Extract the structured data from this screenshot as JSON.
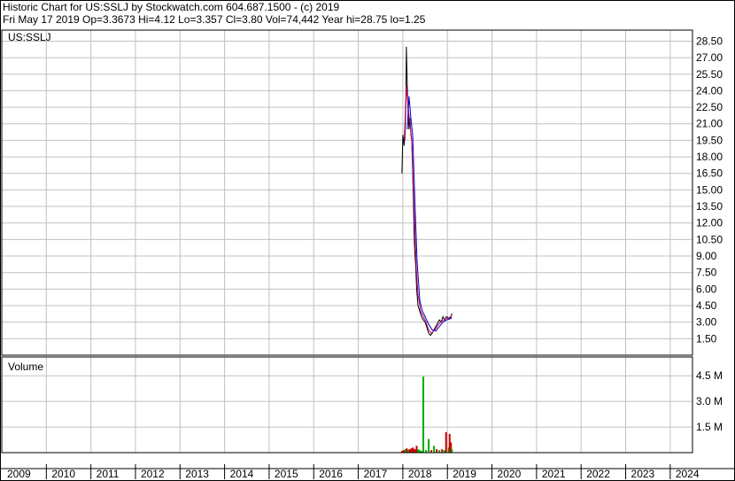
{
  "header": {
    "line1": "Historic Chart for US:SSLJ by Stockwatch.com 604.687.1500 - (c) 2019",
    "line2": "Fri May 17 2019  Op=3.3673  Hi=4.12  Lo=3.357  Cl=3.80  Vol=74,442  Year hi=28.75  lo=1.25"
  },
  "chart_data": [
    {
      "type": "line",
      "panel": "price",
      "label": "US:SSLJ",
      "x_ticks": [
        "2009",
        "2010",
        "2011",
        "2012",
        "2013",
        "2014",
        "2015",
        "2016",
        "2017",
        "2018",
        "2019",
        "2020",
        "2021",
        "2022",
        "2023",
        "2024"
      ],
      "xlim": [
        2009.0,
        2024.5
      ],
      "y_ticks": [
        "28.50",
        "27.00",
        "25.50",
        "24.00",
        "22.50",
        "21.00",
        "19.50",
        "18.00",
        "16.50",
        "15.00",
        "13.50",
        "12.00",
        "10.50",
        "9.00",
        "7.50",
        "6.00",
        "4.50",
        "3.00",
        "1.50"
      ],
      "ylim": [
        0.0,
        29.5
      ],
      "grid": true,
      "series": [
        {
          "role": "price",
          "color": "#000000",
          "points": [
            [
              2017.98,
              16.5
            ],
            [
              2018.0,
              20.0
            ],
            [
              2018.03,
              19.0
            ],
            [
              2018.05,
              21.0
            ],
            [
              2018.07,
              23.5
            ],
            [
              2018.08,
              28.0
            ],
            [
              2018.1,
              24.5
            ],
            [
              2018.12,
              22.0
            ],
            [
              2018.14,
              20.5
            ],
            [
              2018.16,
              21.5
            ],
            [
              2018.18,
              20.0
            ],
            [
              2018.2,
              19.5
            ],
            [
              2018.23,
              15.0
            ],
            [
              2018.26,
              10.0
            ],
            [
              2018.29,
              8.0
            ],
            [
              2018.31,
              6.0
            ],
            [
              2018.34,
              4.5
            ],
            [
              2018.38,
              4.0
            ],
            [
              2018.42,
              3.5
            ],
            [
              2018.46,
              3.2
            ],
            [
              2018.5,
              3.0
            ],
            [
              2018.54,
              2.5
            ],
            [
              2018.58,
              2.0
            ],
            [
              2018.62,
              1.8
            ],
            [
              2018.66,
              2.0
            ],
            [
              2018.7,
              2.3
            ],
            [
              2018.74,
              2.6
            ],
            [
              2018.78,
              2.9
            ],
            [
              2018.82,
              3.2
            ],
            [
              2018.86,
              3.0
            ],
            [
              2018.9,
              3.5
            ],
            [
              2018.94,
              3.2
            ],
            [
              2018.98,
              3.5
            ],
            [
              2019.02,
              3.4
            ],
            [
              2019.05,
              3.3
            ],
            [
              2019.08,
              3.5
            ],
            [
              2019.1,
              3.8
            ]
          ]
        },
        {
          "role": "moving-average-short",
          "color": "#cc0066",
          "points": [
            [
              2018.05,
              19.5
            ],
            [
              2018.08,
              24.5
            ],
            [
              2018.12,
              22.5
            ],
            [
              2018.16,
              21.0
            ],
            [
              2018.2,
              19.5
            ],
            [
              2018.25,
              13.5
            ],
            [
              2018.3,
              8.0
            ],
            [
              2018.34,
              5.5
            ],
            [
              2018.4,
              4.0
            ],
            [
              2018.46,
              3.5
            ],
            [
              2018.52,
              3.0
            ],
            [
              2018.58,
              2.3
            ],
            [
              2018.64,
              2.0
            ],
            [
              2018.72,
              2.3
            ],
            [
              2018.8,
              2.8
            ],
            [
              2018.88,
              3.1
            ],
            [
              2018.96,
              3.3
            ],
            [
              2019.04,
              3.4
            ],
            [
              2019.1,
              3.6
            ]
          ]
        },
        {
          "role": "moving-average-long",
          "color": "#0000cc",
          "points": [
            [
              2018.1,
              20.5
            ],
            [
              2018.14,
              23.5
            ],
            [
              2018.18,
              21.5
            ],
            [
              2018.22,
              20.0
            ],
            [
              2018.27,
              14.0
            ],
            [
              2018.32,
              8.5
            ],
            [
              2018.38,
              5.0
            ],
            [
              2018.44,
              4.0
            ],
            [
              2018.5,
              3.5
            ],
            [
              2018.58,
              2.8
            ],
            [
              2018.66,
              2.3
            ],
            [
              2018.74,
              2.2
            ],
            [
              2018.82,
              2.6
            ],
            [
              2018.9,
              3.0
            ],
            [
              2018.98,
              3.2
            ],
            [
              2019.06,
              3.3
            ],
            [
              2019.1,
              3.4
            ]
          ]
        }
      ]
    },
    {
      "type": "bar",
      "panel": "volume",
      "title": "Volume",
      "y_ticks": [
        "4.5 M",
        "3.0 M",
        "1.5 M"
      ],
      "ylim": [
        0,
        5.6
      ],
      "unit": "M",
      "bars": [
        {
          "x": 2017.98,
          "value": 0.1,
          "color": "#cc0000"
        },
        {
          "x": 2018.02,
          "value": 0.15,
          "color": "#cc0000"
        },
        {
          "x": 2018.06,
          "value": 0.2,
          "color": "#00aa00"
        },
        {
          "x": 2018.09,
          "value": 0.25,
          "color": "#cc0000"
        },
        {
          "x": 2018.12,
          "value": 0.15,
          "color": "#00aa00"
        },
        {
          "x": 2018.15,
          "value": 0.2,
          "color": "#cc0000"
        },
        {
          "x": 2018.19,
          "value": 0.25,
          "color": "#cc0000"
        },
        {
          "x": 2018.23,
          "value": 0.3,
          "color": "#cc0000"
        },
        {
          "x": 2018.27,
          "value": 0.2,
          "color": "#cc0000"
        },
        {
          "x": 2018.31,
          "value": 0.4,
          "color": "#cc0000"
        },
        {
          "x": 2018.34,
          "value": 0.2,
          "color": "#00aa00"
        },
        {
          "x": 2018.38,
          "value": 0.15,
          "color": "#00aa00"
        },
        {
          "x": 2018.42,
          "value": 0.1,
          "color": "#00aa00"
        },
        {
          "x": 2018.46,
          "value": 4.45,
          "color": "#00aa00"
        },
        {
          "x": 2018.52,
          "value": 0.15,
          "color": "#00aa00"
        },
        {
          "x": 2018.58,
          "value": 0.8,
          "color": "#00aa00"
        },
        {
          "x": 2018.64,
          "value": 0.15,
          "color": "#cc0000"
        },
        {
          "x": 2018.7,
          "value": 0.4,
          "color": "#00aa00"
        },
        {
          "x": 2018.76,
          "value": 0.2,
          "color": "#cc0000"
        },
        {
          "x": 2018.82,
          "value": 0.15,
          "color": "#00aa00"
        },
        {
          "x": 2018.88,
          "value": 0.2,
          "color": "#cc0000"
        },
        {
          "x": 2018.93,
          "value": 0.15,
          "color": "#00aa00"
        },
        {
          "x": 2018.97,
          "value": 1.2,
          "color": "#cc0000"
        },
        {
          "x": 2019.03,
          "value": 0.3,
          "color": "#00aa00"
        },
        {
          "x": 2019.05,
          "value": 1.1,
          "color": "#cc0000"
        },
        {
          "x": 2019.08,
          "value": 0.6,
          "color": "#cc0000"
        },
        {
          "x": 2019.1,
          "value": 0.2,
          "color": "#00aa00"
        }
      ]
    }
  ]
}
